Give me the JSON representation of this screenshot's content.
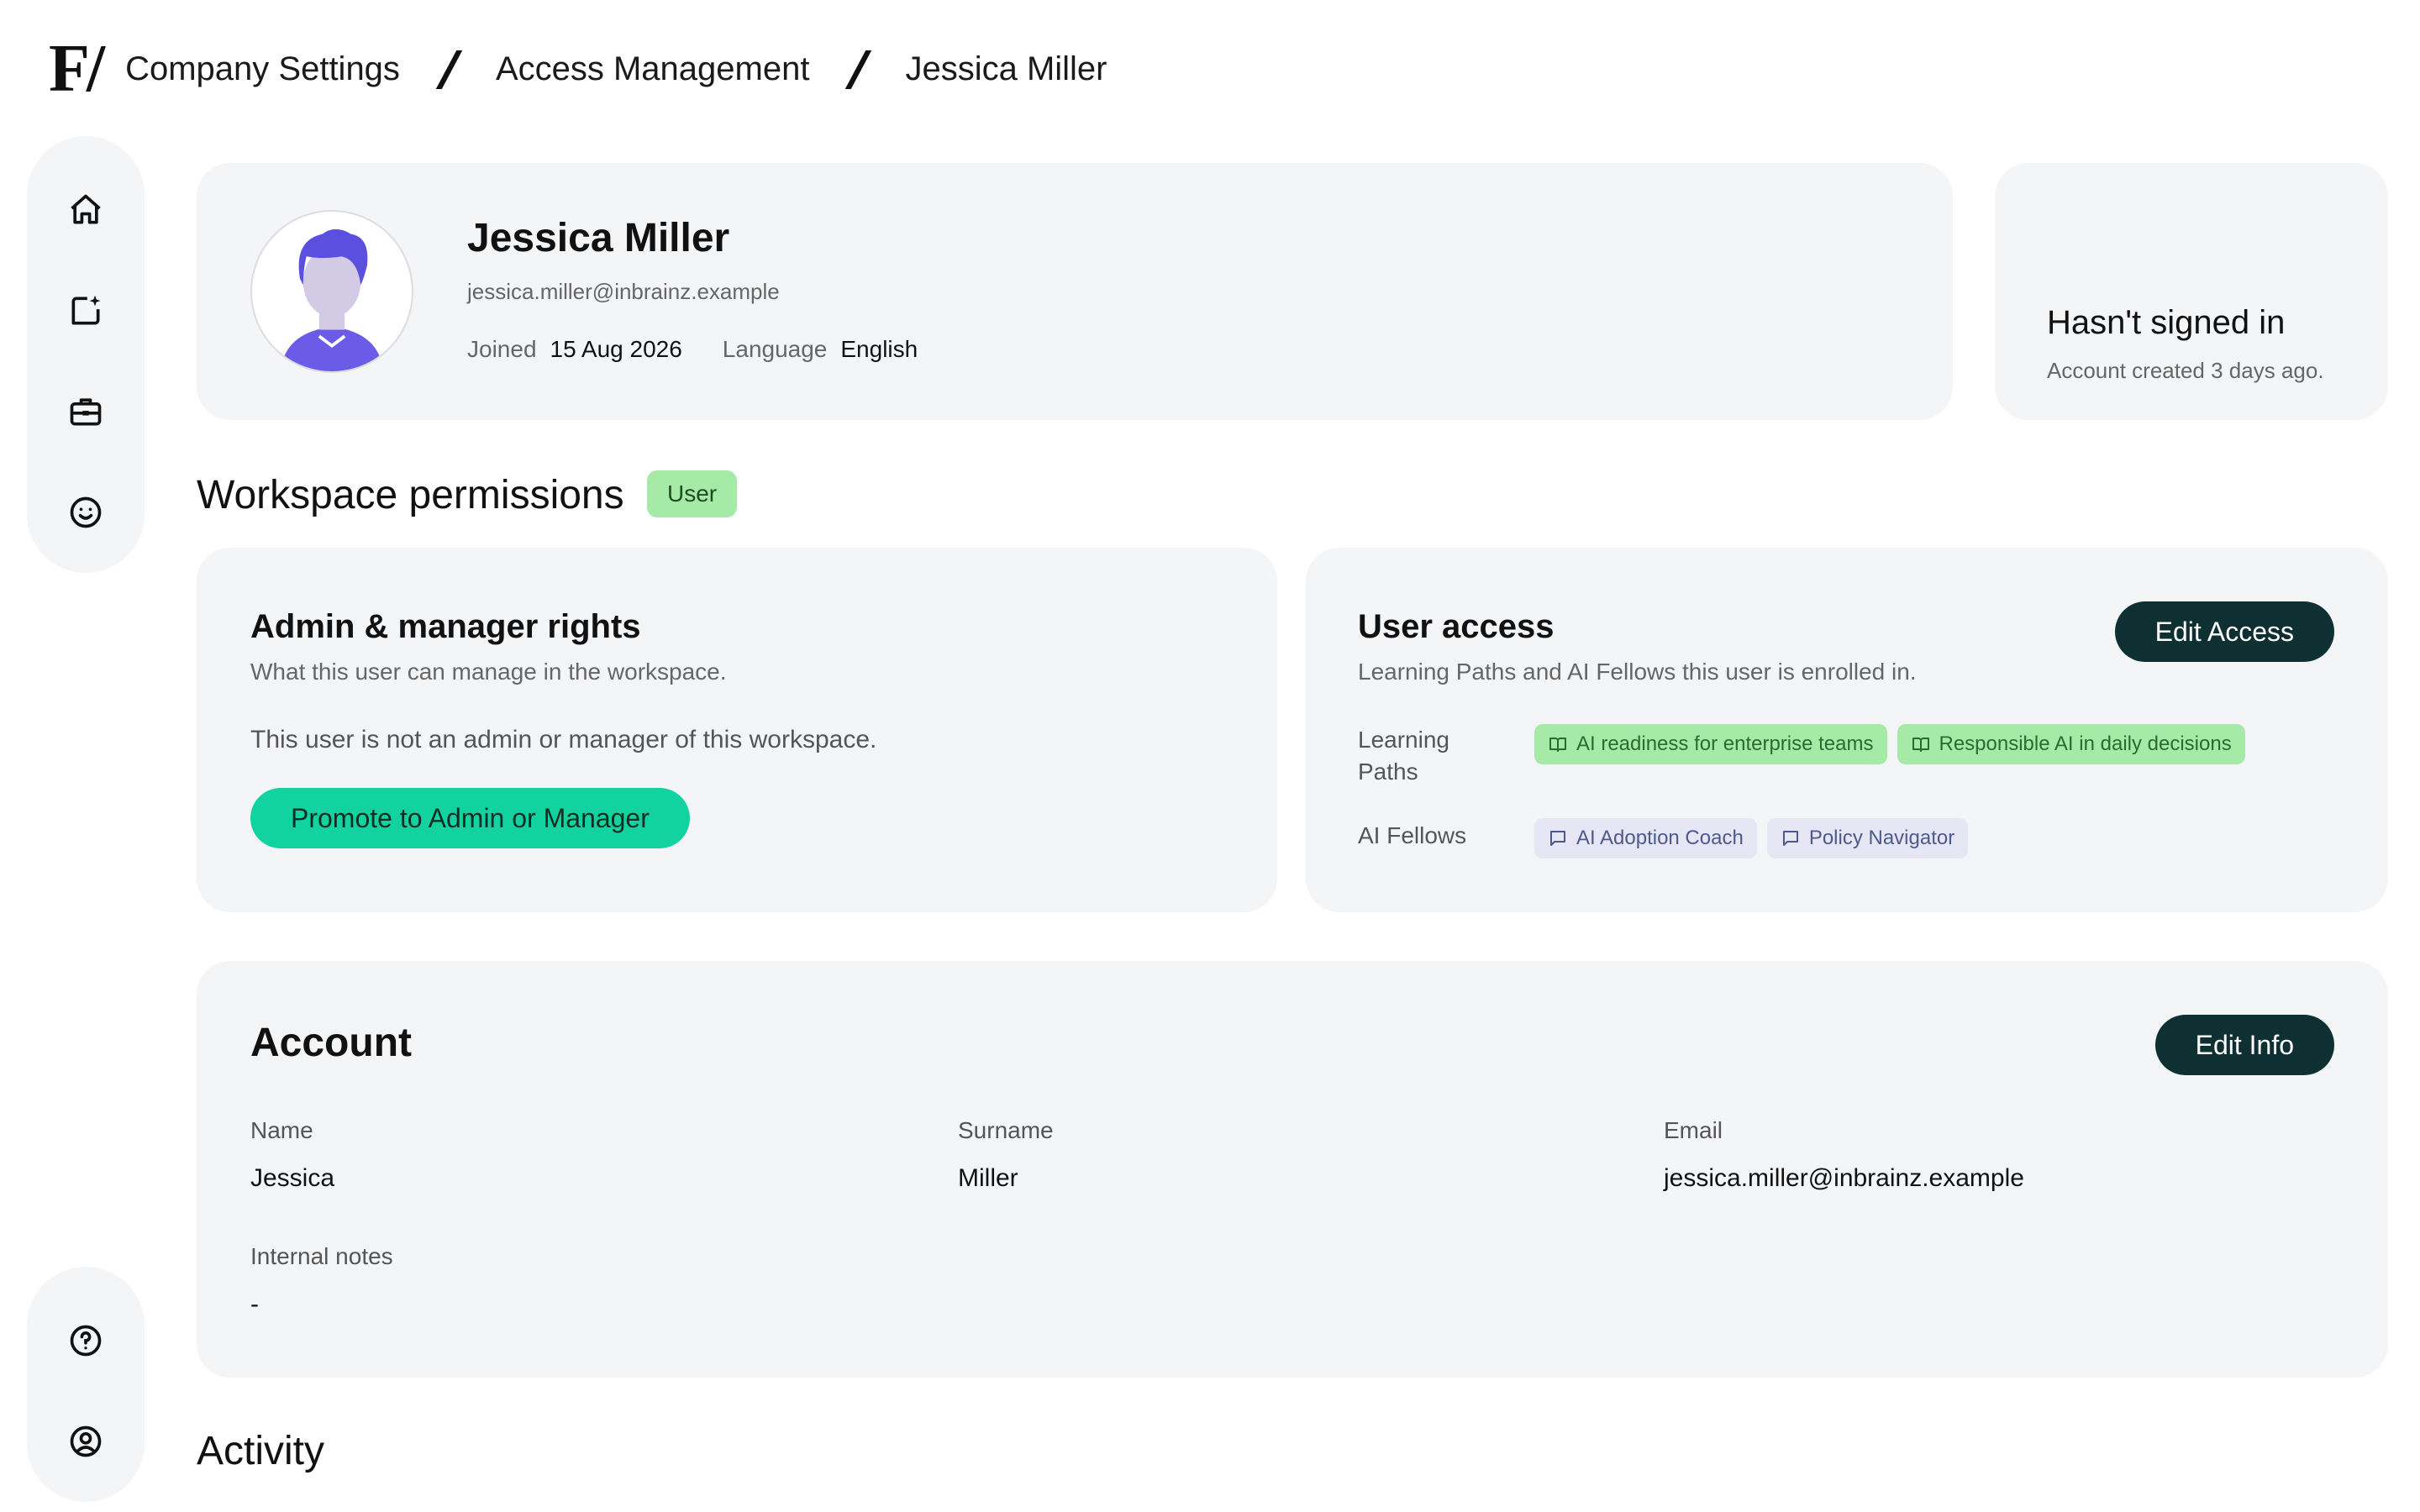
{
  "breadcrumb": {
    "logo": "F/",
    "items": [
      "Company Settings",
      "Access Management",
      "Jessica Miller"
    ]
  },
  "sidebar": {
    "top_icons": [
      "home-icon",
      "new-chat-icon",
      "briefcase-icon",
      "smiley-icon"
    ],
    "bottom_icons": [
      "help-icon",
      "profile-icon"
    ]
  },
  "profile": {
    "name": "Jessica Miller",
    "email": "jessica.miller@inbrainz.example",
    "joined_label": "Joined",
    "joined_value": "15 Aug 2026",
    "language_label": "Language",
    "language_value": "English"
  },
  "signin": {
    "title": "Hasn't signed in",
    "subtitle": "Account created 3 days ago."
  },
  "workspace": {
    "title": "Workspace permissions",
    "role_badge": "User"
  },
  "admin_card": {
    "title": "Admin & manager rights",
    "subtitle": "What this user can manage in the workspace.",
    "note": "This user is not an admin or manager of this workspace.",
    "promote_button": "Promote to Admin or Manager"
  },
  "access_card": {
    "title": "User access",
    "subtitle": "Learning Paths and AI Fellows this user is enrolled in.",
    "edit_button": "Edit Access",
    "learning_paths_label": "Learning Paths",
    "learning_paths": [
      "AI readiness for enterprise teams",
      "Responsible AI in daily decisions"
    ],
    "fellows_label": "AI Fellows",
    "fellows": [
      "AI Adoption Coach",
      "Policy Navigator"
    ]
  },
  "account": {
    "title": "Account",
    "edit_button": "Edit Info",
    "name_label": "Name",
    "name_value": "Jessica",
    "surname_label": "Surname",
    "surname_value": "Miller",
    "email_label": "Email",
    "email_value": "jessica.miller@inbrainz.example",
    "notes_label": "Internal notes",
    "notes_value": "-"
  },
  "activity": {
    "title": "Activity"
  },
  "colors": {
    "card_bg": "#f4f5f7",
    "accent_green": "#12d3a0",
    "dark_button": "#0f3033",
    "badge_green": "#a6eaa8",
    "chip_lavender": "#e6e6f4",
    "avatar_purple": "#5b4fe0"
  }
}
